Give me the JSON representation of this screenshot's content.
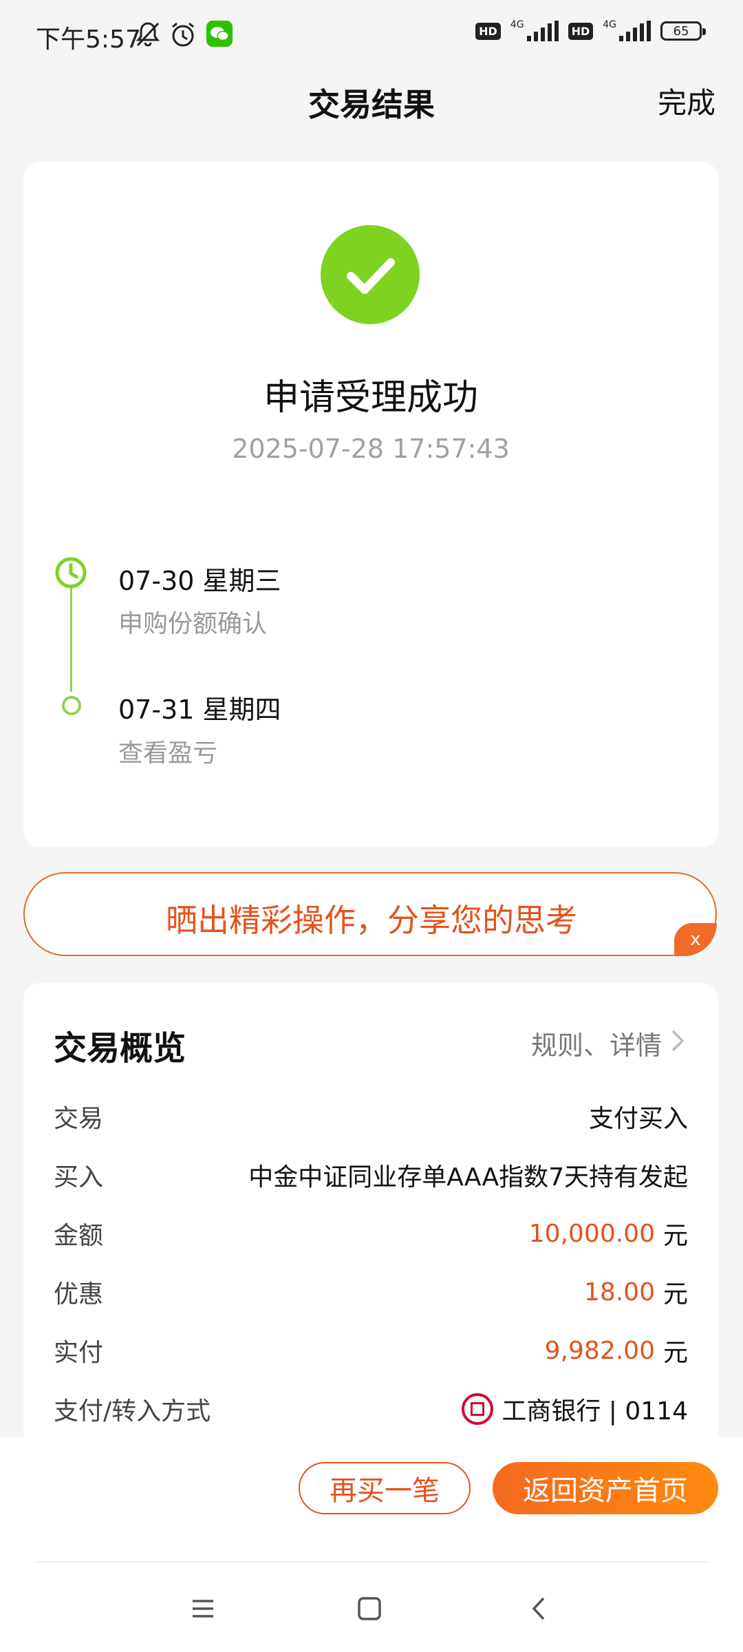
{
  "status_bar": {
    "time": "下午5:57",
    "net1": "4G",
    "net2": "4G",
    "hd": "HD",
    "battery": "65"
  },
  "header": {
    "title": "交易结果",
    "done_label": "完成"
  },
  "result": {
    "title": "申请受理成功",
    "timestamp": "2025-07-28 17:57:43",
    "timeline": [
      {
        "date": "07-30  星期三",
        "desc": "申购份额确认"
      },
      {
        "date": "07-31  星期四",
        "desc": "查看盈亏"
      }
    ],
    "accent_color": "#7ed321"
  },
  "share": {
    "text": "晒出精彩操作，分享您的思考",
    "close": "x"
  },
  "overview": {
    "title": "交易概览",
    "link": "规则、详情",
    "rows": {
      "trade": {
        "label": "交易",
        "value": "支付买入"
      },
      "buy": {
        "label": "买入",
        "value": "中金中证同业存单AAA指数7天持有发起"
      },
      "amount": {
        "label": "金额",
        "value": "10,000.00",
        "unit": "元"
      },
      "discount": {
        "label": "优惠",
        "value": "18.00",
        "unit": "元"
      },
      "paid": {
        "label": "实付",
        "value": "9,982.00",
        "unit": "元"
      },
      "method": {
        "label": "支付/转入方式",
        "value": "工商银行 | 0114"
      }
    }
  },
  "actions": {
    "buy_again": "再买一笔",
    "back_home": "返回资产首页"
  },
  "colors": {
    "brand_orange": "#e4521c",
    "success_green": "#7ed321"
  }
}
